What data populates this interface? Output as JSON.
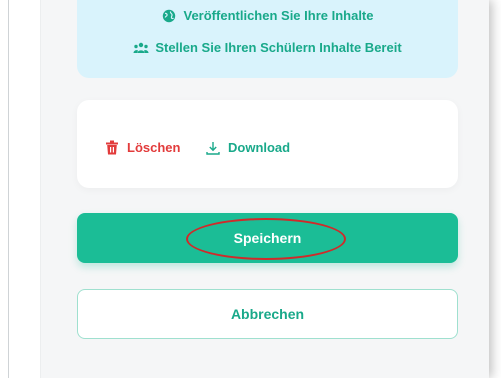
{
  "info": {
    "publish_text": "Veröffentlichen Sie Ihre Inhalte",
    "share_text": "Stellen Sie Ihren Schülern Inhalte Bereit",
    "publish_icon": "globe-icon",
    "share_icon": "users-icon"
  },
  "actions": {
    "delete_label": "Löschen",
    "download_label": "Download",
    "delete_icon": "trash-icon",
    "download_icon": "download-icon"
  },
  "buttons": {
    "save_label": "Speichern",
    "cancel_label": "Abbrechen"
  },
  "colors": {
    "accent": "#1bbd96",
    "accent_text": "#19a98a",
    "danger": "#e23b3b",
    "info_bg": "#d9f3fc",
    "highlight": "#d12a2a"
  }
}
